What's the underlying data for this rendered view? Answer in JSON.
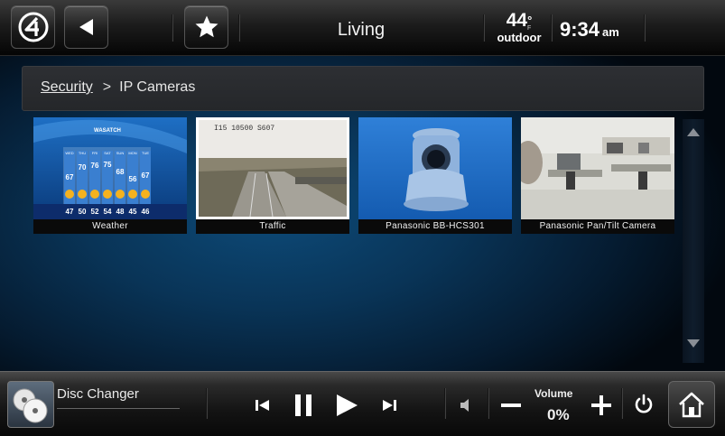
{
  "header": {
    "room": "Living",
    "temperature": "44",
    "temp_unit": "F",
    "temp_label": "outdoor",
    "time": "9:34",
    "ampm": "am"
  },
  "breadcrumb": {
    "parent": "Security",
    "separator": ">",
    "current": "IP Cameras"
  },
  "cameras": [
    {
      "label": "Weather"
    },
    {
      "label": "Traffic"
    },
    {
      "label": "Panasonic BB-HCS301"
    },
    {
      "label": "Panasonic Pan/Tilt Camera"
    }
  ],
  "weather_preview": {
    "station": "WASATCH",
    "days": [
      "WED",
      "THU",
      "FRI",
      "SAT",
      "SUN",
      "MON",
      "TUE"
    ],
    "highs": [
      "67",
      "70",
      "76",
      "75",
      "68",
      "56",
      "67"
    ],
    "lows": [
      "47",
      "50",
      "52",
      "54",
      "48",
      "45",
      "46"
    ]
  },
  "traffic_preview": {
    "overlay_text": "I15 10500 S607"
  },
  "footer": {
    "source": "Disc Changer",
    "volume_label": "Volume",
    "volume_value": "0%"
  },
  "icons": {
    "logo": "control4-logo-icon",
    "back": "back-arrow-icon",
    "favorite": "star-icon",
    "previous": "skip-previous-icon",
    "pause": "pause-icon",
    "play": "play-icon",
    "next": "skip-next-icon",
    "mute": "speaker-icon",
    "volume_down": "minus-icon",
    "volume_up": "plus-icon",
    "power": "power-icon",
    "home": "home-icon",
    "scroll_up": "scroll-up-arrow-icon",
    "scroll_down": "scroll-down-arrow-icon"
  },
  "colors": {
    "accent": "#0d4a78",
    "background": "#051b30"
  }
}
